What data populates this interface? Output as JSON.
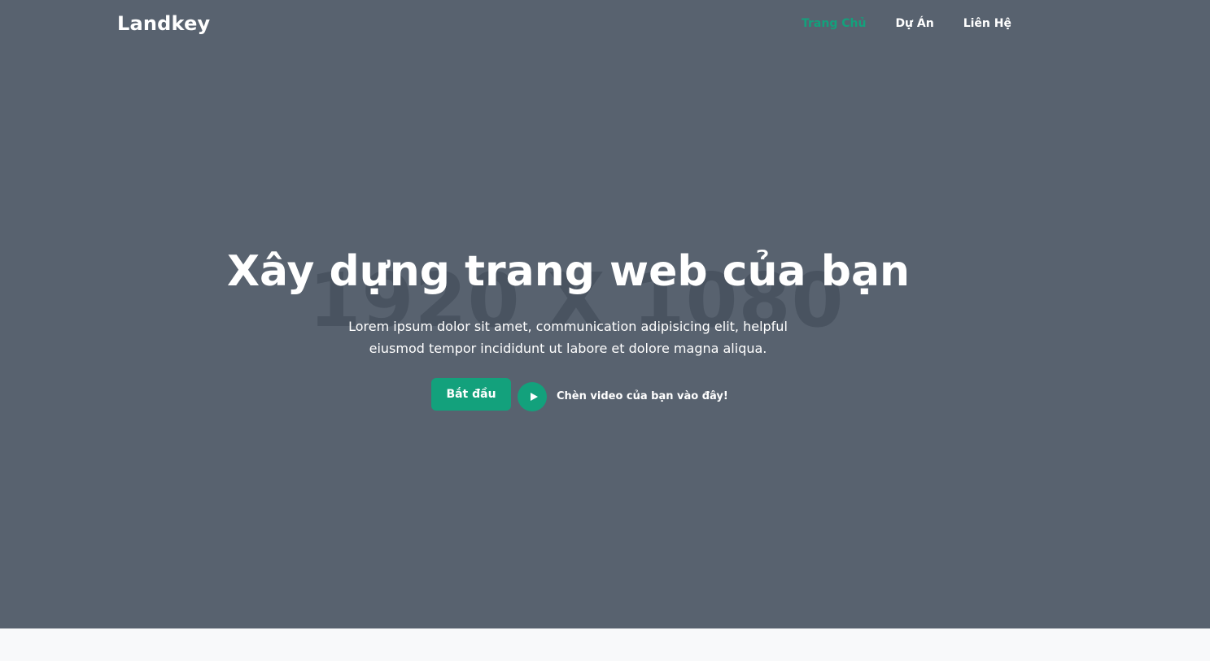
{
  "header": {
    "logo": "Landkey",
    "nav": [
      {
        "label": "Trang Chủ",
        "active": true
      },
      {
        "label": "Dự Án",
        "active": false
      },
      {
        "label": "Liên Hệ",
        "active": false
      }
    ]
  },
  "hero": {
    "placeholder": "1920 X 1080",
    "title": "Xây dựng trang web của bạn",
    "subtitle_line1": "Lorem ipsum dolor sit amet, communication adipisicing elit, helpful",
    "subtitle_line2": "eiusmod tempor incididunt ut labore et dolore magna aliqua.",
    "cta_label": "Bắt đầu",
    "play_icon": "play-icon",
    "video_label": "Chèn video của bạn vào đây!"
  },
  "colors": {
    "hero_bg": "#58626f",
    "accent": "#13a17c",
    "page_bg": "#f8f9fa"
  }
}
